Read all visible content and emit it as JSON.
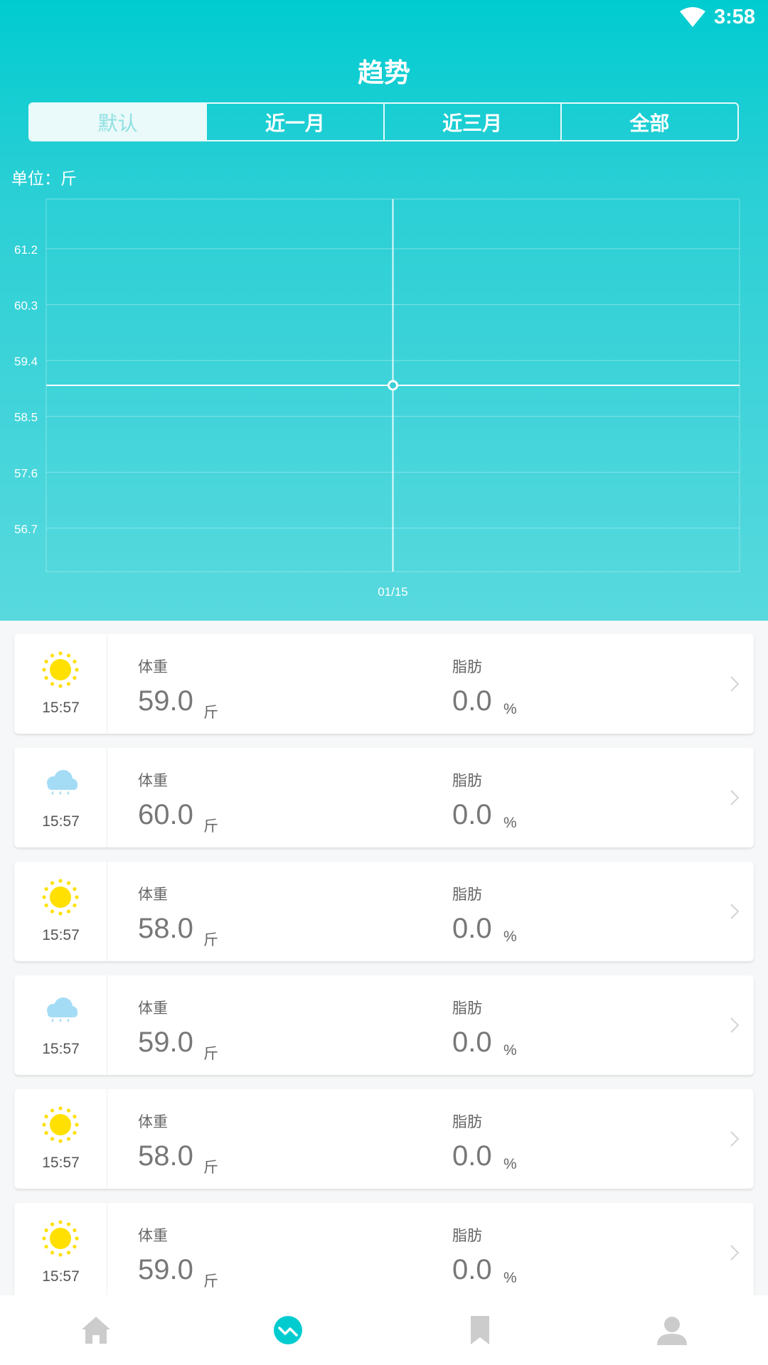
{
  "status": {
    "time": "3:58"
  },
  "title": "趋势",
  "tabs": [
    {
      "label": "默认",
      "active": true
    },
    {
      "label": "近一月"
    },
    {
      "label": "近三月"
    },
    {
      "label": "全部"
    }
  ],
  "unit_label": "单位：斤",
  "chart_data": {
    "type": "line",
    "y_ticks": [
      "61.2",
      "60.3",
      "59.4",
      "58.5",
      "57.6",
      "56.7"
    ],
    "ylim": [
      56.0,
      62.0
    ],
    "x": [
      "01/15"
    ],
    "values": [
      59.0
    ],
    "grid": true,
    "line_color": "#ffffff"
  },
  "records": [
    {
      "icon": "sun-icon",
      "time": "15:57",
      "weight_label": "体重",
      "weight": "59.0",
      "weight_unit": "斤",
      "fat_label": "脂肪",
      "fat": "0.0",
      "fat_unit": "%"
    },
    {
      "icon": "rain-cloud-icon",
      "time": "15:57",
      "weight_label": "体重",
      "weight": "60.0",
      "weight_unit": "斤",
      "fat_label": "脂肪",
      "fat": "0.0",
      "fat_unit": "%"
    },
    {
      "icon": "sun-icon",
      "time": "15:57",
      "weight_label": "体重",
      "weight": "58.0",
      "weight_unit": "斤",
      "fat_label": "脂肪",
      "fat": "0.0",
      "fat_unit": "%"
    },
    {
      "icon": "rain-cloud-icon",
      "time": "15:57",
      "weight_label": "体重",
      "weight": "59.0",
      "weight_unit": "斤",
      "fat_label": "脂肪",
      "fat": "0.0",
      "fat_unit": "%"
    },
    {
      "icon": "sun-icon",
      "time": "15:57",
      "weight_label": "体重",
      "weight": "58.0",
      "weight_unit": "斤",
      "fat_label": "脂肪",
      "fat": "0.0",
      "fat_unit": "%"
    },
    {
      "icon": "sun-icon",
      "time": "15:57",
      "weight_label": "体重",
      "weight": "59.0",
      "weight_unit": "斤",
      "fat_label": "脂肪",
      "fat": "0.0",
      "fat_unit": "%"
    }
  ],
  "nav": [
    {
      "icon": "home-icon",
      "active": false
    },
    {
      "icon": "trend-icon",
      "active": true
    },
    {
      "icon": "bookmark-icon",
      "active": false
    },
    {
      "icon": "profile-icon",
      "active": false
    }
  ],
  "colors": {
    "accent": "#00ccd0",
    "nav_inactive": "#cccccc",
    "sun": "#ffe000",
    "rain": "#a5dcf5"
  }
}
